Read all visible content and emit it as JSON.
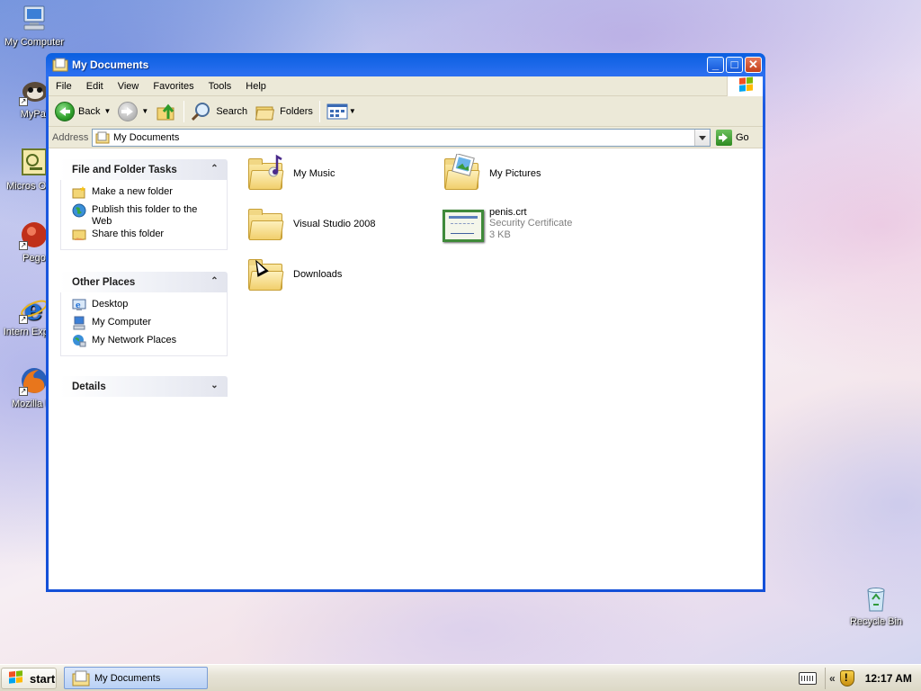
{
  "desktop": {
    "icons": [
      {
        "label": "My Computer"
      },
      {
        "label": "MyPal"
      },
      {
        "label": "Micros Outlo"
      },
      {
        "label": "Pego"
      },
      {
        "label": "Intern Explore"
      },
      {
        "label": "Mozilla Fir"
      },
      {
        "label": "Recycle Bin"
      }
    ]
  },
  "window": {
    "title": "My Documents",
    "menu": [
      "File",
      "Edit",
      "View",
      "Favorites",
      "Tools",
      "Help"
    ],
    "toolbar": {
      "back_label": "Back",
      "search_label": "Search",
      "folders_label": "Folders"
    },
    "address": {
      "label": "Address",
      "value": "My Documents",
      "go_label": "Go"
    },
    "taskpane": {
      "file_tasks": {
        "title": "File and Folder Tasks",
        "links": [
          {
            "label": "Make a new folder",
            "icon": "new-folder-icon"
          },
          {
            "label": "Publish this folder to the Web",
            "icon": "globe-icon"
          },
          {
            "label": "Share this folder",
            "icon": "share-folder-icon"
          }
        ]
      },
      "other_places": {
        "title": "Other Places",
        "links": [
          {
            "label": "Desktop",
            "icon": "desktop-icon"
          },
          {
            "label": "My Computer",
            "icon": "computer-icon"
          },
          {
            "label": "My Network Places",
            "icon": "network-icon"
          }
        ]
      },
      "details": {
        "title": "Details"
      }
    },
    "items": [
      {
        "name": "My Music",
        "icon": "music-folder-icon"
      },
      {
        "name": "My Pictures",
        "icon": "pictures-folder-icon"
      },
      {
        "name": "Visual Studio 2008",
        "icon": "folder-icon"
      },
      {
        "name": "penis.crt",
        "type": "Security Certificate",
        "size": "3 KB",
        "icon": "certificate-icon"
      },
      {
        "name": "Downloads",
        "icon": "folder-icon"
      }
    ]
  },
  "taskbar": {
    "start_label": "start",
    "task_label": "My Documents",
    "tray_chevron": "«",
    "time": "12:17 AM"
  },
  "colors": {
    "title_blue": "#1450d8",
    "chrome": "#ece9d8",
    "taskbar": "#e6e3d6"
  }
}
